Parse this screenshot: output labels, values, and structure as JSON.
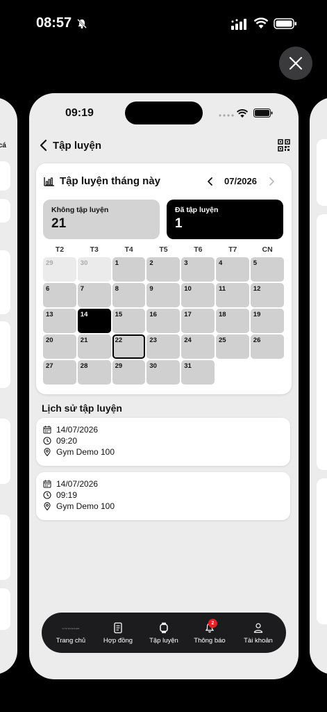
{
  "status_bar": {
    "time": "08:57"
  },
  "inner_status": {
    "time": "09:19"
  },
  "side_left": {
    "peek_text": "cá"
  },
  "header": {
    "title": "Tập luyện"
  },
  "calendar": {
    "title": "Tập luyện tháng này",
    "month": "07/2026",
    "stats": {
      "not_trained_label": "Không tập luyện",
      "not_trained_value": "21",
      "trained_label": "Đã tập luyện",
      "trained_value": "1"
    },
    "weekdays": [
      "T2",
      "T3",
      "T4",
      "T5",
      "T6",
      "T7",
      "CN"
    ],
    "days": [
      {
        "n": "29",
        "state": "out"
      },
      {
        "n": "30",
        "state": "out"
      },
      {
        "n": "1"
      },
      {
        "n": "2"
      },
      {
        "n": "3"
      },
      {
        "n": "4"
      },
      {
        "n": "5"
      },
      {
        "n": "6"
      },
      {
        "n": "7"
      },
      {
        "n": "8"
      },
      {
        "n": "9"
      },
      {
        "n": "10"
      },
      {
        "n": "11"
      },
      {
        "n": "12"
      },
      {
        "n": "13"
      },
      {
        "n": "14",
        "state": "done"
      },
      {
        "n": "15"
      },
      {
        "n": "16"
      },
      {
        "n": "17"
      },
      {
        "n": "18"
      },
      {
        "n": "19"
      },
      {
        "n": "20"
      },
      {
        "n": "21"
      },
      {
        "n": "22",
        "state": "today"
      },
      {
        "n": "23"
      },
      {
        "n": "24"
      },
      {
        "n": "25"
      },
      {
        "n": "26"
      },
      {
        "n": "27"
      },
      {
        "n": "28"
      },
      {
        "n": "29"
      },
      {
        "n": "30"
      },
      {
        "n": "31"
      }
    ]
  },
  "history": {
    "title": "Lịch sử tập luyện",
    "items": [
      {
        "date": "14/07/2026",
        "time": "09:20",
        "location": "Gym Demo 100"
      },
      {
        "date": "14/07/2026",
        "time": "09:19",
        "location": "Gym Demo 100"
      }
    ]
  },
  "tabbar": {
    "tabs": [
      {
        "label": "Trang chủ",
        "icon": "logo-icon",
        "logo_text": "GYM MANAGER"
      },
      {
        "label": "Hợp đồng",
        "icon": "contract-icon"
      },
      {
        "label": "Tập luyện",
        "icon": "watch-icon"
      },
      {
        "label": "Thông báo",
        "icon": "bell-icon",
        "badge": "2"
      },
      {
        "label": "Tài khoản",
        "icon": "user-icon"
      }
    ]
  },
  "colors": {
    "accent": "#000000",
    "badge": "#e02424",
    "card": "#ffffff",
    "background": "#ececec"
  }
}
